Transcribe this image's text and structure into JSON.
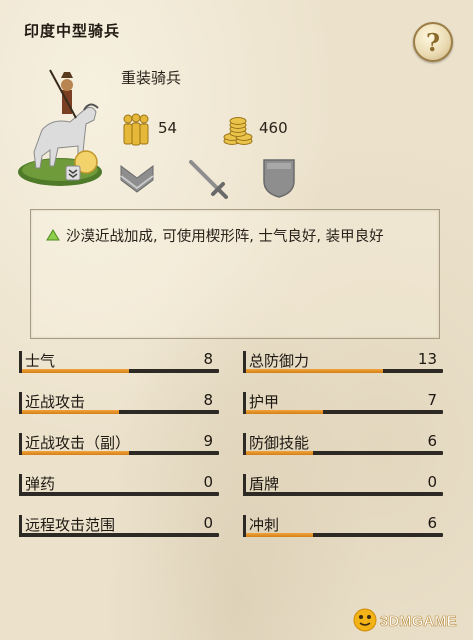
{
  "unit": {
    "name": "印度中型骑兵",
    "class": "重装骑兵",
    "men": "54",
    "cost": "460",
    "help_symbol": "?"
  },
  "abilities": [
    "wedge-chevron-icon",
    "sword-icon",
    "shield-icon"
  ],
  "description": "沙漠近战加成, 可使用楔形阵, 士气良好, 装甲良好",
  "stats": [
    {
      "label": "士气",
      "value": "8",
      "fill": 0.55
    },
    {
      "label": "总防御力",
      "value": "13",
      "fill": 0.7
    },
    {
      "label": "近战攻击",
      "value": "8",
      "fill": 0.5
    },
    {
      "label": "护甲",
      "value": "7",
      "fill": 0.4
    },
    {
      "label": "近战攻击（副）",
      "value": "9",
      "fill": 0.55
    },
    {
      "label": "防御技能",
      "value": "6",
      "fill": 0.35
    },
    {
      "label": "弹药",
      "value": "0",
      "fill": 0
    },
    {
      "label": "盾牌",
      "value": "0",
      "fill": 0
    },
    {
      "label": "远程攻击范围",
      "value": "0",
      "fill": 0
    },
    {
      "label": "冲刺",
      "value": "6",
      "fill": 0.35
    }
  ],
  "watermark": "3DMGAME",
  "colors": {
    "accent": "#e3921f",
    "rail": "#2d2a26",
    "gold": "#d7a32a",
    "positive": "#7fbf3f"
  }
}
